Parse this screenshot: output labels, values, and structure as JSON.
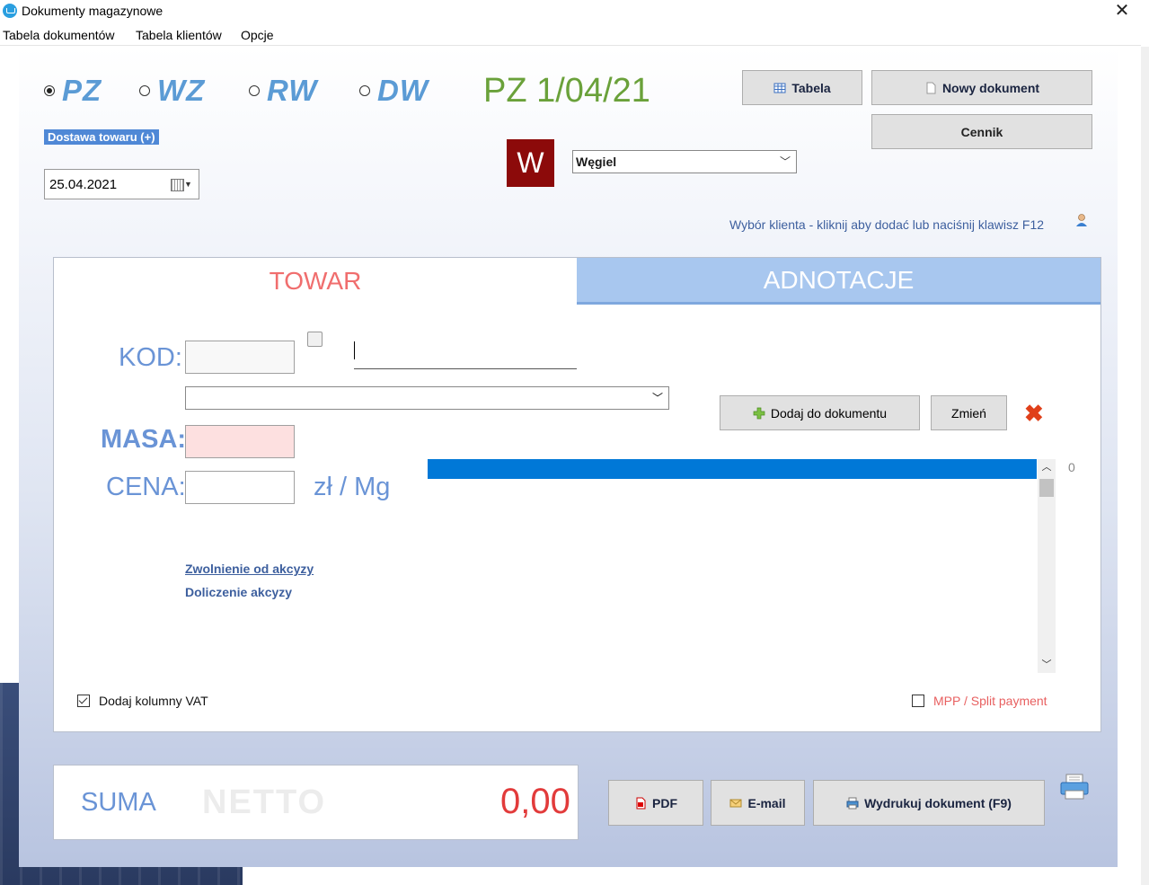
{
  "window": {
    "title": "Dokumenty magazynowe",
    "close": "✕"
  },
  "menu": [
    {
      "label": "Tabela dokumentów"
    },
    {
      "label": "Tabela klientów"
    },
    {
      "label": "Opcje"
    }
  ],
  "doc_types": [
    {
      "label": "PZ",
      "selected": true
    },
    {
      "label": "WZ",
      "selected": false
    },
    {
      "label": "RW",
      "selected": false
    },
    {
      "label": "DW",
      "selected": false
    }
  ],
  "doc_number": "PZ 1/04/21",
  "doc_subtype_badge": "Dostawa towaru (+)",
  "date": "25.04.2021",
  "toolbar": {
    "table_label": "Tabela",
    "new_doc_label": "Nowy dokument",
    "price_list_label": "Cennik"
  },
  "client": {
    "avatar_letter": "W",
    "selected": "Węgiel",
    "hint": "Wybór klienta - kliknij aby dodać lub naciśnij klawisz F12"
  },
  "tabs": [
    {
      "label": "TOWAR",
      "active": true
    },
    {
      "label": "ADNOTACJE",
      "active": false
    }
  ],
  "form": {
    "kod_label": "KOD:",
    "kod_value": "",
    "name_value": "",
    "product_value": "",
    "masa_label": "MASA:",
    "masa_value": "",
    "cena_label": "CENA:",
    "cena_value": "",
    "unit": "zł / Mg",
    "add_button": "Dodaj do dokumentu",
    "change_button": "Zmień",
    "link_excise_exempt": "Zwolnienie od akcyzy",
    "link_excise_add": "Doliczenie akcyzy",
    "vat_checkbox": {
      "label": "Dodaj kolumny VAT",
      "checked": true
    },
    "mpp_checkbox": {
      "label": "MPP / Split payment",
      "checked": false
    }
  },
  "list": {
    "item_count": "0",
    "items": []
  },
  "summary": {
    "label": "SUMA",
    "netto_label": "NETTO",
    "value": "0,00"
  },
  "actions": {
    "pdf": "PDF",
    "email": "E-mail",
    "print": "Wydrukuj dokument (F9)"
  },
  "colors": {
    "accent_blue": "#5b9bd5",
    "doc_number_green": "#6aa13a",
    "tab_active_text": "#f06e6e",
    "tab_inactive_bg": "#a8c7ef",
    "list_header": "#0078d7",
    "sum_value": "#e23b3b",
    "avatar_bg": "#8c0a0a"
  },
  "icons": {
    "table": "table-icon",
    "new_doc": "document-icon",
    "add": "plus-icon",
    "delete": "delete-x-icon",
    "pdf": "pdf-icon",
    "email": "envelope-icon",
    "print": "printer-icon",
    "user": "user-icon",
    "lock": "lock-icon",
    "calendar": "calendar-icon"
  }
}
